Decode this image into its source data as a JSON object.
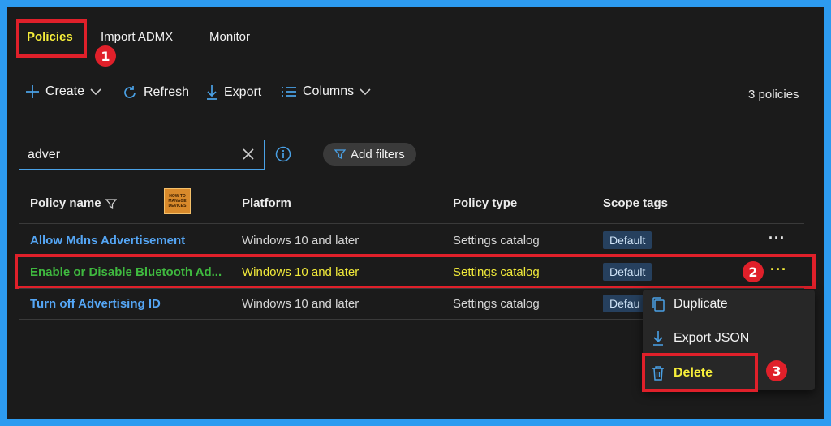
{
  "tabs": [
    {
      "label": "Policies",
      "active": true
    },
    {
      "label": "Import ADMX",
      "active": false
    },
    {
      "label": "Monitor",
      "active": false
    }
  ],
  "toolbar": {
    "create": "Create",
    "refresh": "Refresh",
    "export": "Export",
    "columns": "Columns",
    "count": "3 policies"
  },
  "search": {
    "value": "adver"
  },
  "filters": {
    "add_label": "Add filters"
  },
  "table": {
    "headers": [
      "Policy name",
      "Platform",
      "Policy type",
      "Scope tags"
    ],
    "rows": [
      {
        "name": "Allow Mdns Advertisement",
        "platform": "Windows 10 and later",
        "type": "Settings catalog",
        "scope": "Default"
      },
      {
        "name": "Enable or Disable Bluetooth Ad...",
        "platform": "Windows 10 and later",
        "type": "Settings catalog",
        "scope": "Default"
      },
      {
        "name": "Turn off Advertising ID",
        "platform": "Windows 10 and later",
        "type": "Settings catalog",
        "scope": "Defau"
      }
    ]
  },
  "context_menu": {
    "items": [
      "Duplicate",
      "Export JSON",
      "Delete"
    ]
  },
  "callouts": [
    "1",
    "2",
    "3"
  ],
  "logo": {
    "line1": "HOW TO",
    "line2": "MANAGE",
    "line3": "DEVICES"
  },
  "colors": {
    "border": "#2d9bf0",
    "background": "#1b1b1b",
    "highlight_red": "#e0202a",
    "active_yellow": "#f6ee3a",
    "link_blue": "#55a6f5",
    "green_text": "#3fb93f"
  }
}
